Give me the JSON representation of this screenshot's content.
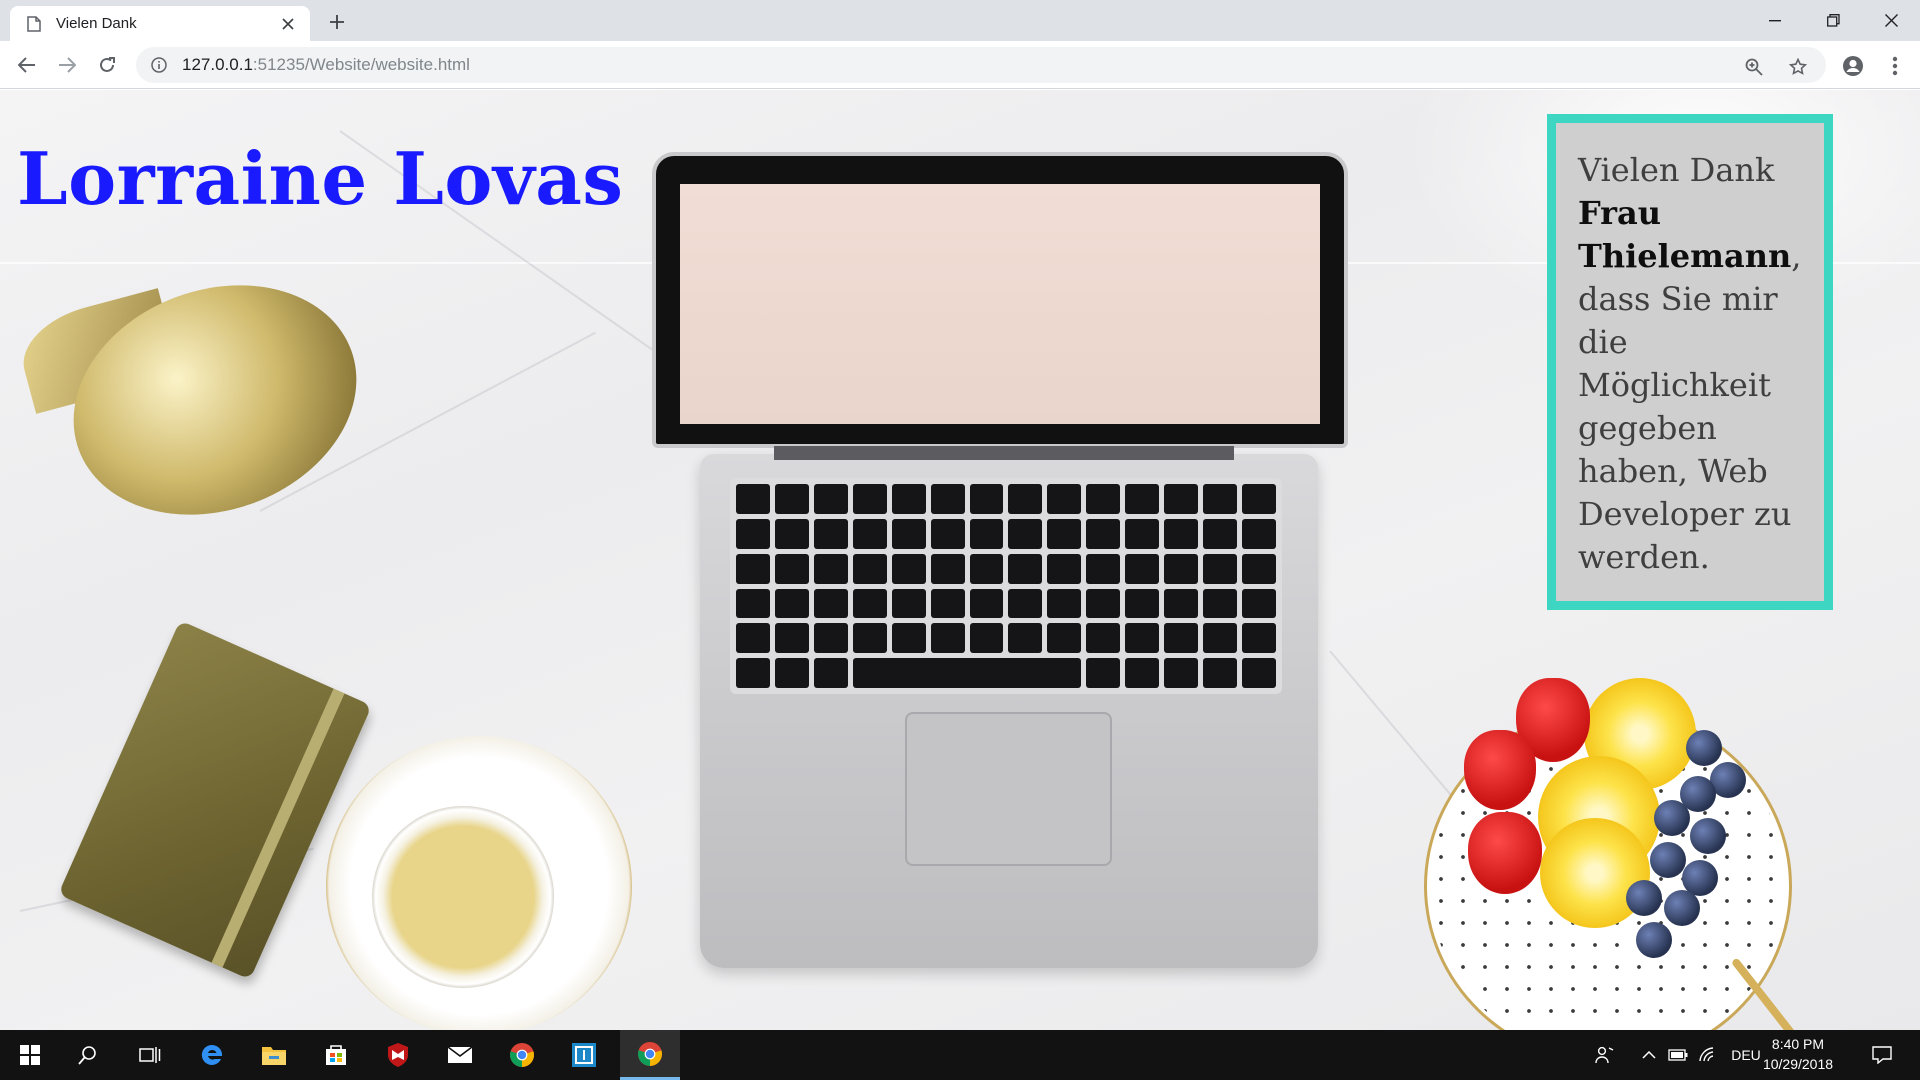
{
  "browser": {
    "tab_title": "Vielen Dank",
    "url_main": "127.0.0.1",
    "url_rest": ":51235/Website/website.html",
    "icons": {
      "favicon": "document-icon",
      "close": "close-icon",
      "new_tab": "plus-icon",
      "back": "back-arrow-icon",
      "forward": "forward-arrow-icon",
      "reload": "reload-icon",
      "info": "info-icon",
      "zoom": "zoom-icon",
      "bookmark": "star-icon",
      "profile": "account-icon",
      "menu": "more-vert-icon"
    }
  },
  "page": {
    "site_title": "Lorraine Lovas",
    "card": {
      "line1": "Vielen Dank",
      "name": "Frau Thielemann",
      "comma": ",",
      "rest": "dass Sie mir die Möglichkeit gegeben haben, Web Developer zu werden."
    },
    "colors": {
      "title": "#1a1aff",
      "card_border": "#3cd6c3",
      "card_bg": "#cfcfcf"
    }
  },
  "taskbar": {
    "apps": [
      "start-icon",
      "search-icon",
      "task-view-icon",
      "edge-icon",
      "file-explorer-icon",
      "store-icon",
      "mcafee-icon",
      "mail-icon",
      "chrome-icon",
      "app-icon",
      "chrome-active-icon"
    ],
    "language": "DEU",
    "time": "8:40 PM",
    "date": "10/29/2018"
  }
}
